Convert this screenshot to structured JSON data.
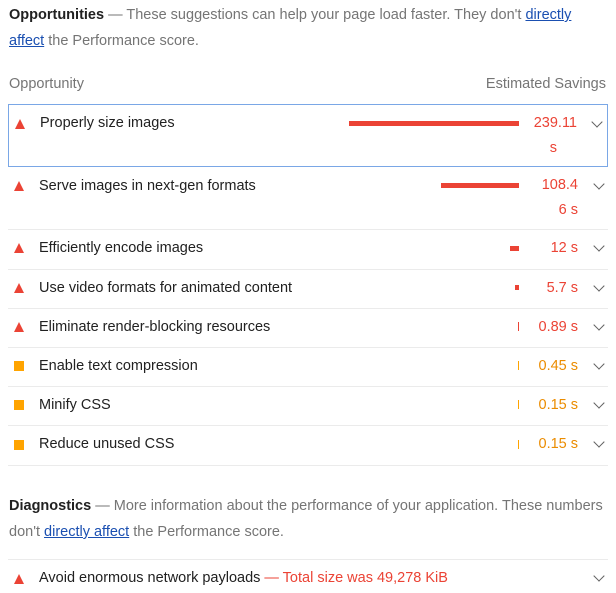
{
  "opportunities": {
    "title": "Opportunities",
    "desc_prefix": " — These suggestions can help your page load faster. They don't ",
    "link": "directly affect",
    "desc_suffix": " the Performance score.",
    "col_left": "Opportunity",
    "col_right": "Estimated Savings",
    "items": [
      {
        "label": "Properly size images",
        "savings": "239.11 s",
        "savings_line1": "239.11",
        "savings_line2": "s",
        "status": "fail",
        "bar_fraction": 1.0
      },
      {
        "label": "Serve images in next-gen formats",
        "savings": "108.46 s",
        "savings_line1": "108.4",
        "savings_line2": "6 s",
        "status": "fail",
        "bar_fraction": 0.45
      },
      {
        "label": "Efficiently encode images",
        "savings": "12 s",
        "status": "fail",
        "bar_fraction": 0.05
      },
      {
        "label": "Use video formats for animated content",
        "savings": "5.7 s",
        "status": "fail",
        "bar_fraction": 0.024
      },
      {
        "label": "Eliminate render-blocking resources",
        "savings": "0.89 s",
        "status": "fail",
        "bar_fraction": 0.004
      },
      {
        "label": "Enable text compression",
        "savings": "0.45 s",
        "status": "average",
        "bar_fraction": 0.002
      },
      {
        "label": "Minify CSS",
        "savings": "0.15 s",
        "status": "average",
        "bar_fraction": 0.001
      },
      {
        "label": "Reduce unused CSS",
        "savings": "0.15 s",
        "status": "average",
        "bar_fraction": 0.001
      }
    ]
  },
  "diagnostics": {
    "title": "Diagnostics",
    "desc_prefix": " — More information about the performance of your application. These numbers don't ",
    "link": "directly affect",
    "desc_suffix": " the Performance score.",
    "items": [
      {
        "label": "Avoid enormous network payloads",
        "detail": " — Total size was 49,278 KiB",
        "status": "fail"
      }
    ]
  },
  "colors": {
    "fail": "#eb4335",
    "average": "#ffa400",
    "link": "#1a4fb1"
  }
}
